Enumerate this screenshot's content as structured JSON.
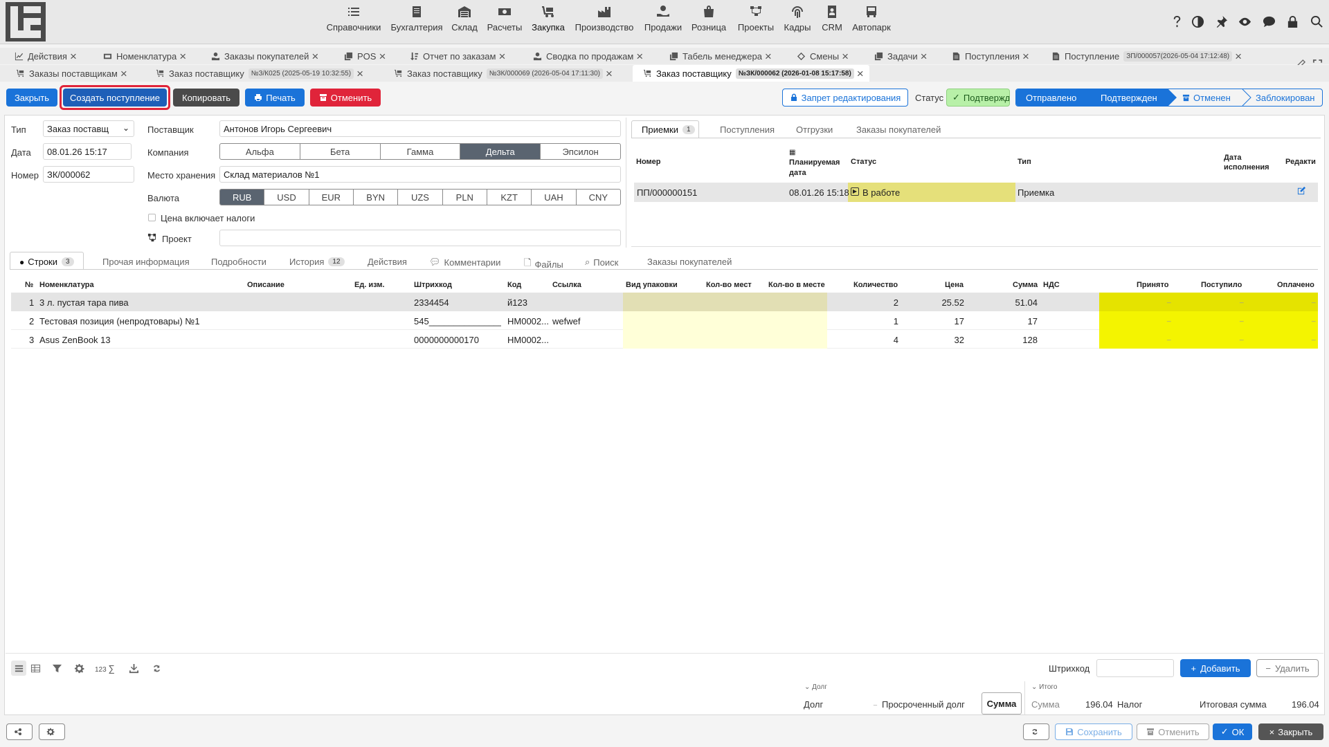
{
  "topnav": [
    {
      "label": "Справочники",
      "icon": "list-check-icon"
    },
    {
      "label": "Бухгалтерия",
      "icon": "ledger-icon"
    },
    {
      "label": "Склад",
      "icon": "warehouse-icon"
    },
    {
      "label": "Расчеты",
      "icon": "money-icon"
    },
    {
      "label": "Закупка",
      "icon": "cart-icon"
    },
    {
      "label": "Производство",
      "icon": "factory-icon"
    },
    {
      "label": "Продажи",
      "icon": "hand-coin-icon"
    },
    {
      "label": "Розница",
      "icon": "bag-icon"
    },
    {
      "label": "Проекты",
      "icon": "project-icon"
    },
    {
      "label": "Кадры",
      "icon": "fingerprint-icon"
    },
    {
      "label": "CRM",
      "icon": "contact-icon"
    },
    {
      "label": "Автопарк",
      "icon": "bus-icon"
    }
  ],
  "tabs_row1": [
    {
      "label": "Действия"
    },
    {
      "label": "Номенклатура"
    },
    {
      "label": "Заказы покупателей"
    },
    {
      "label": "POS"
    },
    {
      "label": "Отчет по заказам"
    },
    {
      "label": "Сводка по продажам"
    },
    {
      "label": "Табель менеджера"
    },
    {
      "label": "Смены"
    },
    {
      "label": "Задачи"
    },
    {
      "label": "Поступления"
    },
    {
      "label": "Поступление",
      "pill": "ЗП/000057(2026-05-04 17:12:48)"
    }
  ],
  "tabs_row2": [
    {
      "label": "Заказы поставщикам"
    },
    {
      "label": "Заказ поставщику",
      "pill": "№З/К025 (2025-05-19 10:32:55)"
    },
    {
      "label": "Заказ поставщику",
      "pill": "№ЗК/000069 (2026-05-04 17:11:30)"
    },
    {
      "label": "Заказ поставщику",
      "pill": "№ЗК/000062 (2026-01-08 15:17:58)"
    }
  ],
  "toolbar": {
    "close": "Закрыть",
    "create_receipt": "Создать поступление",
    "copy": "Копировать",
    "print": "Печать",
    "cancel": "Отменить",
    "edit_lock": "Запрет редактирования",
    "status_label": "Статус",
    "status_value": "Подтвержд",
    "stages": [
      "Отправлено",
      "Подтвержден",
      "Отменен",
      "Заблокирован"
    ]
  },
  "form": {
    "type_label": "Тип",
    "type_value": "Заказ поставщ",
    "date_label": "Дата",
    "date_value": "08.01.26 15:17",
    "number_label": "Номер",
    "number_value": "ЗК/000062",
    "supplier_label": "Поставщик",
    "supplier_value": "Антонов Игорь Сергеевич",
    "company_label": "Компания",
    "companies": [
      "Альфа",
      "Бета",
      "Гамма",
      "Дельта",
      "Эпсилон"
    ],
    "company_selected": "Дельта",
    "storage_label": "Место хранения",
    "storage_value": "Склад материалов №1",
    "currency_label": "Валюта",
    "currencies": [
      "RUB",
      "USD",
      "EUR",
      "BYN",
      "UZS",
      "PLN",
      "KZT",
      "UAH",
      "CNY"
    ],
    "currency_selected": "RUB",
    "tax_included": "Цена включает налоги",
    "project_label": "Проект"
  },
  "right_tabs": [
    {
      "label": "Приемки",
      "badge": "1"
    },
    {
      "label": "Поступления"
    },
    {
      "label": "Отгрузки"
    },
    {
      "label": "Заказы покупателей"
    }
  ],
  "receipts": {
    "headers": {
      "number": "Номер",
      "planned": "Планируемая дата",
      "status": "Статус",
      "type": "Тип",
      "done": "Дата исполнения",
      "edit": "Редакти"
    },
    "rows": [
      {
        "number": "ПП/000000151",
        "planned": "08.01.26 15:18",
        "status": "В работе",
        "type": "Приемка"
      }
    ]
  },
  "lines_tabs": [
    {
      "label": "Строки",
      "badge": "3"
    },
    {
      "label": "Прочая информация"
    },
    {
      "label": "Подробности"
    },
    {
      "label": "История",
      "badge": "12"
    },
    {
      "label": "Действия"
    },
    {
      "label": "Комментарии"
    },
    {
      "label": "Файлы"
    },
    {
      "label": "Поиск"
    },
    {
      "label": "Заказы покупателей"
    }
  ],
  "lines": {
    "headers": {
      "n": "№",
      "item": "Номенклатура",
      "desc": "Описание",
      "unit": "Ед. изм.",
      "barcode": "Штрихкод",
      "code": "Код",
      "link": "Ссылка",
      "pack": "Вид упаковки",
      "places": "Кол-во мест",
      "per_place": "Кол-во в месте",
      "qty": "Количество",
      "price": "Цена",
      "sum": "Сумма",
      "vat": "НДС",
      "accepted": "Принято",
      "received": "Поступило",
      "paid": "Оплачено"
    },
    "rows": [
      {
        "n": "1",
        "item": "3 л. пустая тара пива",
        "barcode": "2334454",
        "code": "й123",
        "link": "",
        "qty": "2",
        "price": "25.52",
        "sum": "51.04",
        "accepted": "_",
        "received": "_",
        "paid": "_"
      },
      {
        "n": "2",
        "item": "Тестовая позиция (непродтовары) №1",
        "barcode": "545_______________...",
        "code": "НМ0002...",
        "link": "wefwef",
        "qty": "1",
        "price": "17",
        "sum": "17",
        "accepted": "_",
        "received": "_",
        "paid": "_"
      },
      {
        "n": "3",
        "item": "Asus ZenBook 13",
        "barcode": "0000000000170",
        "code": "НМ0002...",
        "link": "",
        "qty": "4",
        "price": "32",
        "sum": "128",
        "accepted": "_",
        "received": "_",
        "paid": "_"
      }
    ]
  },
  "footer": {
    "sigma_label": "123",
    "barcode_label": "Штрихкод",
    "add": "Добавить",
    "delete": "Удалить",
    "debt_section": "Долг",
    "debt": "Долг",
    "debt_value": "_",
    "overdue": "Просроченный долг",
    "sum_button": "Сумма",
    "total_section": "Итого",
    "sum_label": "Сумма",
    "sum_value": "196.04",
    "tax_label": "Налог",
    "grand_label": "Итоговая сумма",
    "grand_value": "196.04"
  },
  "bottom": {
    "save": "Сохранить",
    "cancel": "Отменить",
    "ok": "ОК",
    "close": "Закрыть"
  },
  "colors": {
    "primary": "#1a73d9",
    "danger": "#e0243a",
    "yellow": "#f4f400",
    "status_yellow": "#e5e07a",
    "confirmed": "#b8f0a8"
  }
}
